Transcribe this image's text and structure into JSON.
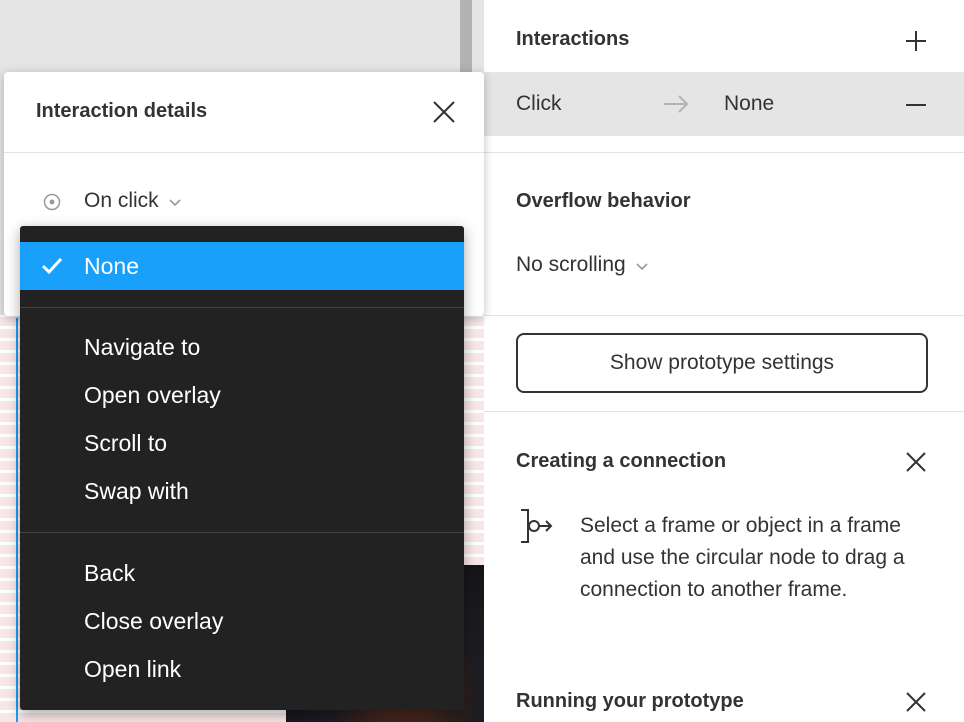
{
  "canvas": {},
  "interactions": {
    "title": "Interactions",
    "row": {
      "trigger": "Click",
      "action": "None"
    }
  },
  "overflow": {
    "title": "Overflow behavior",
    "value": "No scrolling"
  },
  "prototype_settings_button": "Show prototype settings",
  "creating_connection": {
    "title": "Creating a connection",
    "text": "Select a frame or object in a frame and use the circular node to drag a connection to another frame."
  },
  "running_prototype": {
    "title": "Running your prototype"
  },
  "interaction_details": {
    "title": "Interaction details",
    "trigger": "On click"
  },
  "dropdown": {
    "selected": "None",
    "group1": [
      "Navigate to",
      "Open overlay",
      "Scroll to",
      "Swap with"
    ],
    "group2": [
      "Back",
      "Close overlay",
      "Open link"
    ]
  },
  "colors": {
    "accent": "#18a0fb",
    "menu_bg": "#222222"
  },
  "icons": [
    "plus-icon",
    "arrow-right-icon",
    "minus-icon",
    "chevron-down-icon",
    "close-icon",
    "connection-node-icon",
    "radio-target-icon",
    "checkmark-icon"
  ]
}
